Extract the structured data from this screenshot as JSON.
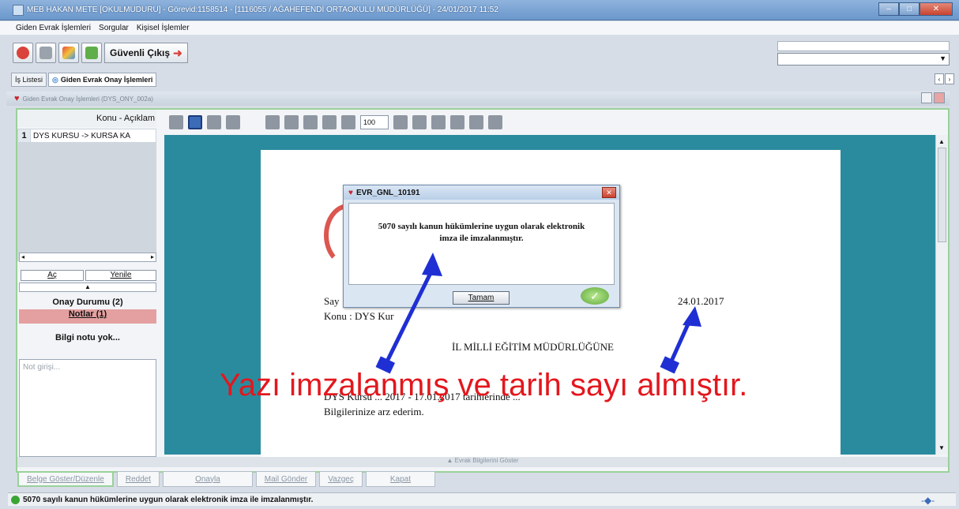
{
  "window": {
    "title": "MEB  HAKAN METE  [OKULMUDURU] - Görevid:1158514 - [1116055 / AĞAHEFENDİ ORTAOKULU MÜDÜRLÜĞÜ] - 24/01/2017 11:52",
    "controls": [
      "minimize",
      "maximize",
      "close"
    ]
  },
  "menu": [
    "Giden Evrak İşlemleri",
    "Sorgular",
    "Kişisel İşlemler"
  ],
  "toolbar": {
    "secure_exit_label": "Güvenli Çıkış"
  },
  "tabs": [
    {
      "label": "İş Listesi"
    },
    {
      "label": "Giden Evrak Onay İşlemleri"
    }
  ],
  "panel": {
    "title": "Giden Evrak Onay İşlemleri (DYS_ONY_002a)"
  },
  "left_panel": {
    "column_header": "Konu - Açıklam",
    "row_number": "1",
    "row_text": "DYS KURSU -> KURSA KA",
    "open_button": "Aç",
    "refresh_button": "Yenile",
    "approval_status": "Onay Durumu (2)",
    "notes": "Notlar (1)",
    "info": "Bilgi notu yok...",
    "note_placeholder": "Not girişi..."
  },
  "doc_toolbar": {
    "zoom": "100"
  },
  "document": {
    "sayi_prefix": "Say",
    "date": "24.01.2017",
    "konu": "Konu : DYS Kur",
    "addressee": "İL MİLLİ EĞİTİM MÜDÜRLÜĞÜNE",
    "body_line1": "DYS Kursu ... 2017 - 17.01.2017 tarihlerinde ...",
    "body_line2": "Bilgilerinize arz ederim."
  },
  "dialog": {
    "title": "EVR_GNL_10191",
    "message": "5070 sayılı kanun hükümlerine uygun olarak elektronik imza ile imzalanmıştır.",
    "ok_button": "Tamam"
  },
  "annotation": {
    "text": "Yazı imzalanmış ve tarih sayı almıştır.",
    "color": "#e3171d",
    "arrow_color": "#1f2fd4"
  },
  "bottom": {
    "evrak_toggle": "Evrak Bilgilerini Göster",
    "actions": [
      "Belge Göster/Düzenle",
      "Reddet",
      "Onayla",
      "Mail Gönder",
      "Vazgeç",
      "Kapat"
    ]
  },
  "status": {
    "message": "5070 sayılı kanun hükümlerine uygun olarak elektronik imza ile imzalanmıştır."
  }
}
